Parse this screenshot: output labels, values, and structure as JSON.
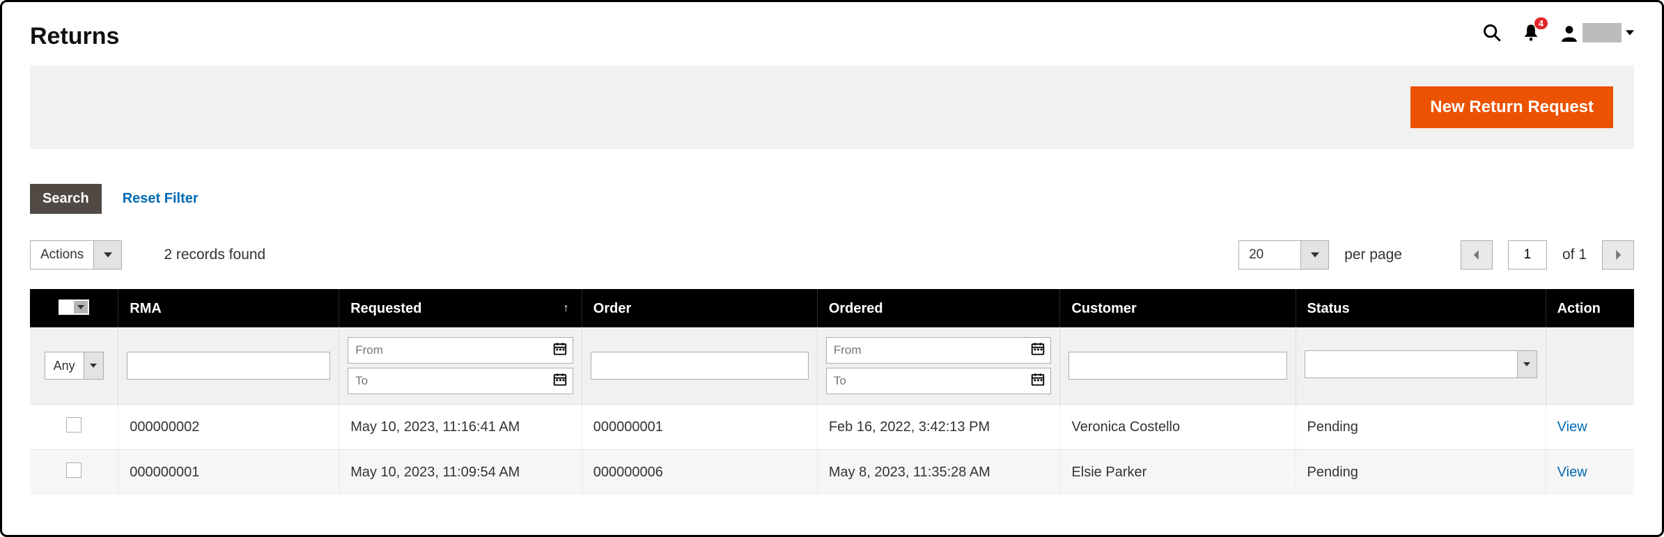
{
  "header": {
    "title": "Returns",
    "notifications_count": "4"
  },
  "banner": {
    "new_return_label": "New Return Request"
  },
  "controls": {
    "search_label": "Search",
    "reset_filter_label": "Reset Filter"
  },
  "toolbar": {
    "actions_label": "Actions",
    "records_found": "2 records found",
    "page_size": "20",
    "per_page_label": "per page",
    "current_page": "1",
    "of_label": "of 1"
  },
  "columns": {
    "rma": "RMA",
    "requested": "Requested",
    "order": "Order",
    "ordered": "Ordered",
    "customer": "Customer",
    "status": "Status",
    "action": "Action"
  },
  "filters": {
    "any_label": "Any",
    "from_ph": "From",
    "to_ph": "To"
  },
  "rows": [
    {
      "rma": "000000002",
      "requested": "May 10, 2023, 11:16:41 AM",
      "order": "000000001",
      "ordered": "Feb 16, 2022, 3:42:13 PM",
      "customer": "Veronica Costello",
      "status": "Pending",
      "action": "View"
    },
    {
      "rma": "000000001",
      "requested": "May 10, 2023, 11:09:54 AM",
      "order": "000000006",
      "ordered": "May 8, 2023, 11:35:28 AM",
      "customer": "Elsie Parker",
      "status": "Pending",
      "action": "View"
    }
  ]
}
